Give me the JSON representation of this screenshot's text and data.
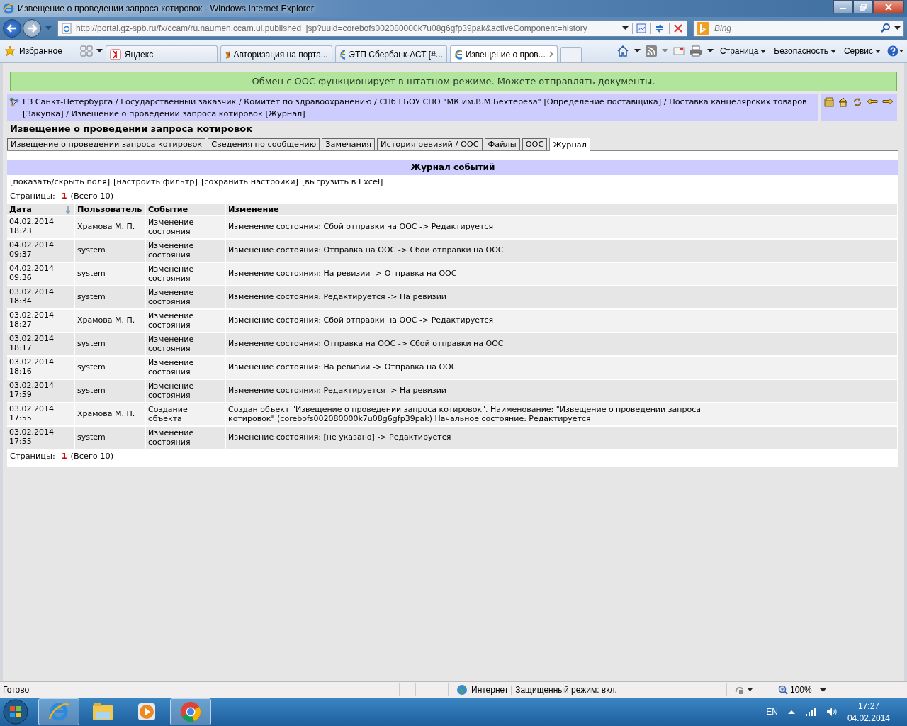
{
  "window": {
    "title": "Извещение о проведении запроса котировок - Windows Internet Explorer"
  },
  "address": {
    "url": "http://portal.gz-spb.ru/fx/ccam/ru.naumen.ccam.ui.published_jsp?uuid=corebofs002080000k7u08g6gfp39pak&activeComponent=history"
  },
  "search": {
    "placeholder": "Bing"
  },
  "favorites": {
    "label": "Избранное"
  },
  "browser_tabs": [
    {
      "label": "Яндекс",
      "selected": false,
      "kind": "yandex"
    },
    {
      "label": "Авторизация на порта...",
      "selected": false,
      "kind": "emblem"
    },
    {
      "label": "ЭТП Сбербанк-АСТ [#...",
      "selected": false,
      "kind": "ie"
    },
    {
      "label": "Извещение о пров...",
      "selected": true,
      "kind": "ie"
    }
  ],
  "commands": [
    "Страница",
    "Безопасность",
    "Сервис"
  ],
  "page": {
    "banner": "Обмен с ООС функционирует в штатном режиме. Можете отправлять документы.",
    "breadcrumb": "ГЗ Санкт-Петербурга / Государственный заказчик / Комитет по здравоохранению / СПб ГБОУ СПО \"МК им.В.М.Бехтерева\" [Определение поставщика] / Поставка канцелярских товаров [Закупка] / Извещение о проведении запроса котировок [Журнал]",
    "heading": "Извещение о проведении запроса котировок",
    "tabs": [
      {
        "label": "Извещение о проведении запроса котировок",
        "selected": false
      },
      {
        "label": "Сведения по сообщению",
        "selected": false
      },
      {
        "label": "Замечания",
        "selected": false
      },
      {
        "label": "История ревизий / ООС",
        "selected": false
      },
      {
        "label": "Файлы",
        "selected": false
      },
      {
        "label": "ООС",
        "selected": false
      },
      {
        "label": "Журнал",
        "selected": true
      }
    ],
    "journal": {
      "title": "Журнал событий",
      "actions": [
        "[показать/скрыть поля]",
        "[настроить фильтр]",
        "[сохранить настройки]",
        "[выгрузить в Excel]"
      ],
      "pager_top": {
        "label": "Страницы:",
        "current": "1",
        "total": "(Всего 10)"
      },
      "columns": [
        "Дата",
        "Пользователь",
        "Событие",
        "Изменение"
      ],
      "rows": [
        {
          "date": "04.02.2014",
          "time": "18:23",
          "user": "Храмова М. П.",
          "event": "Изменение состояния",
          "change": "Изменение состояния: Сбой отправки на ООС -> Редактируется"
        },
        {
          "date": "04.02.2014",
          "time": "09:37",
          "user": "system",
          "event": "Изменение состояния",
          "change": "Изменение состояния: Отправка на ООС -> Сбой отправки на ООС"
        },
        {
          "date": "04.02.2014",
          "time": "09:36",
          "user": "system",
          "event": "Изменение состояния",
          "change": "Изменение состояния: На ревизии -> Отправка на ООС"
        },
        {
          "date": "03.02.2014",
          "time": "18:34",
          "user": "system",
          "event": "Изменение состояния",
          "change": "Изменение состояния: Редактируется -> На ревизии"
        },
        {
          "date": "03.02.2014",
          "time": "18:27",
          "user": "Храмова М. П.",
          "event": "Изменение состояния",
          "change": "Изменение состояния: Сбой отправки на ООС -> Редактируется"
        },
        {
          "date": "03.02.2014",
          "time": "18:17",
          "user": "system",
          "event": "Изменение состояния",
          "change": "Изменение состояния: Отправка на ООС -> Сбой отправки на ООС"
        },
        {
          "date": "03.02.2014",
          "time": "18:16",
          "user": "system",
          "event": "Изменение состояния",
          "change": "Изменение состояния: На ревизии -> Отправка на ООС"
        },
        {
          "date": "03.02.2014",
          "time": "17:59",
          "user": "system",
          "event": "Изменение состояния",
          "change": "Изменение состояния: Редактируется -> На ревизии"
        },
        {
          "date": "03.02.2014",
          "time": "17:55",
          "user": "Храмова М. П.",
          "event": "Создание объекта",
          "change": "Создан объект \"Извещение о проведении запроса котировок\". Наименование: \"Извещение о проведении запроса котировок\" (corebofs002080000k7u08g6gfp39pak) Начальное состояние: Редактируется"
        },
        {
          "date": "03.02.2014",
          "time": "17:55",
          "user": "system",
          "event": "Изменение состояния",
          "change": "Изменение состояния: [не указано] -> Редактируется"
        }
      ],
      "pager_bottom": {
        "label": "Страницы:",
        "current": "1",
        "total": "(Всего 10)"
      }
    }
  },
  "status_bar": {
    "text": "Готово",
    "zone": "Интернет | Защищенный режим: вкл.",
    "zoom": "100%"
  },
  "taskbar": {
    "apps": [
      {
        "kind": "ie",
        "running": true
      },
      {
        "kind": "explorer",
        "running": false
      },
      {
        "kind": "media",
        "running": false
      },
      {
        "kind": "chrome",
        "running": true
      }
    ],
    "language": "EN",
    "time": "17:27",
    "date": "04.02.2014"
  }
}
